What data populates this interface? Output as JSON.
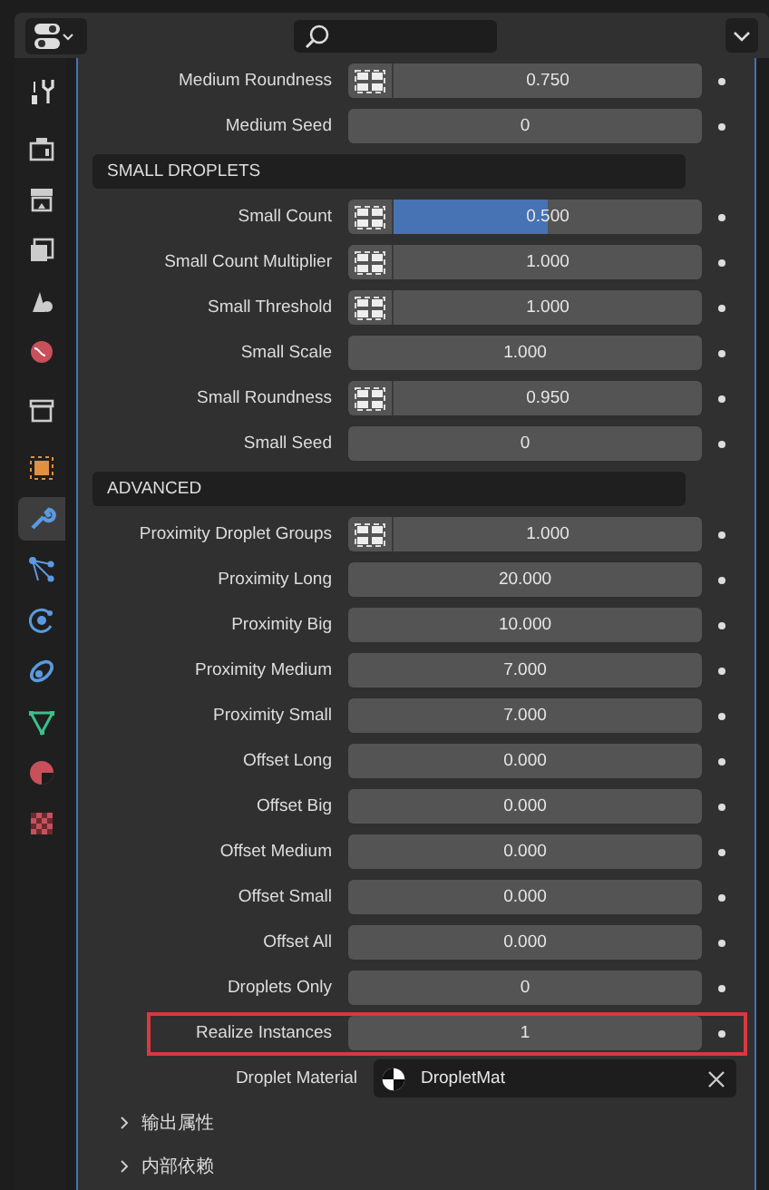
{
  "sidebar": {
    "tab_groups": [
      [
        {
          "kind": "tool",
          "selected": false
        }
      ],
      [
        {
          "kind": "render",
          "selected": false
        },
        {
          "kind": "output",
          "selected": false
        },
        {
          "kind": "view_layer",
          "selected": false
        },
        {
          "kind": "scene",
          "selected": false
        },
        {
          "kind": "world",
          "selected": false
        }
      ],
      [
        {
          "kind": "collection",
          "selected": false
        }
      ],
      [
        {
          "kind": "object",
          "selected": false
        },
        {
          "kind": "modifiers",
          "selected": true
        },
        {
          "kind": "particles",
          "selected": false
        },
        {
          "kind": "physics",
          "selected": false
        },
        {
          "kind": "constraints",
          "selected": false
        },
        {
          "kind": "data",
          "selected": false
        },
        {
          "kind": "material",
          "selected": false
        },
        {
          "kind": "texture",
          "selected": false
        }
      ]
    ]
  },
  "rows": [
    {
      "kind": "field",
      "label": "Medium Roundness",
      "value": "0.750",
      "toggle": true,
      "highlighted": false
    },
    {
      "kind": "field",
      "label": "Medium Seed",
      "value": "0",
      "toggle": false,
      "highlighted": false
    },
    {
      "kind": "section",
      "label": "SMALL DROPLETS"
    },
    {
      "kind": "field",
      "label": "Small Count",
      "value": "0.500",
      "toggle": true,
      "level": 0.5,
      "highlighted": false
    },
    {
      "kind": "field",
      "label": "Small Count Multiplier",
      "value": "1.000",
      "toggle": true,
      "highlighted": false
    },
    {
      "kind": "field",
      "label": "Small Threshold",
      "value": "1.000",
      "toggle": true,
      "highlighted": false
    },
    {
      "kind": "field",
      "label": "Small Scale",
      "value": "1.000",
      "toggle": false,
      "highlighted": false
    },
    {
      "kind": "field",
      "label": "Small Roundness",
      "value": "0.950",
      "toggle": true,
      "highlighted": false
    },
    {
      "kind": "field",
      "label": "Small Seed",
      "value": "0",
      "toggle": false,
      "highlighted": false
    },
    {
      "kind": "section",
      "label": "ADVANCED"
    },
    {
      "kind": "field",
      "label": "Proximity Droplet Groups",
      "value": "1.000",
      "toggle": true,
      "highlighted": false
    },
    {
      "kind": "field",
      "label": "Proximity Long",
      "value": "20.000",
      "toggle": false,
      "highlighted": false
    },
    {
      "kind": "field",
      "label": "Proximity Big",
      "value": "10.000",
      "toggle": false,
      "highlighted": false
    },
    {
      "kind": "field",
      "label": "Proximity Medium",
      "value": "7.000",
      "toggle": false,
      "highlighted": false
    },
    {
      "kind": "field",
      "label": "Proximity Small",
      "value": "7.000",
      "toggle": false,
      "highlighted": false
    },
    {
      "kind": "field",
      "label": "Offset Long",
      "value": "0.000",
      "toggle": false,
      "highlighted": false
    },
    {
      "kind": "field",
      "label": "Offset Big",
      "value": "0.000",
      "toggle": false,
      "highlighted": false
    },
    {
      "kind": "field",
      "label": "Offset Medium",
      "value": "0.000",
      "toggle": false,
      "highlighted": false
    },
    {
      "kind": "field",
      "label": "Offset Small",
      "value": "0.000",
      "toggle": false,
      "highlighted": false
    },
    {
      "kind": "field",
      "label": "Offset All",
      "value": "0.000",
      "toggle": false,
      "highlighted": false
    },
    {
      "kind": "field",
      "label": "Droplets Only",
      "value": "0",
      "toggle": false,
      "highlighted": false
    },
    {
      "kind": "field",
      "label": "Realize Instances",
      "value": "1",
      "toggle": false,
      "highlighted": true
    },
    {
      "kind": "material",
      "label": "Droplet Material",
      "value": "DropletMat"
    }
  ],
  "subpanels": [
    {
      "label": "输出属性",
      "expanded": false
    },
    {
      "label": "内部依赖",
      "expanded": false
    }
  ]
}
